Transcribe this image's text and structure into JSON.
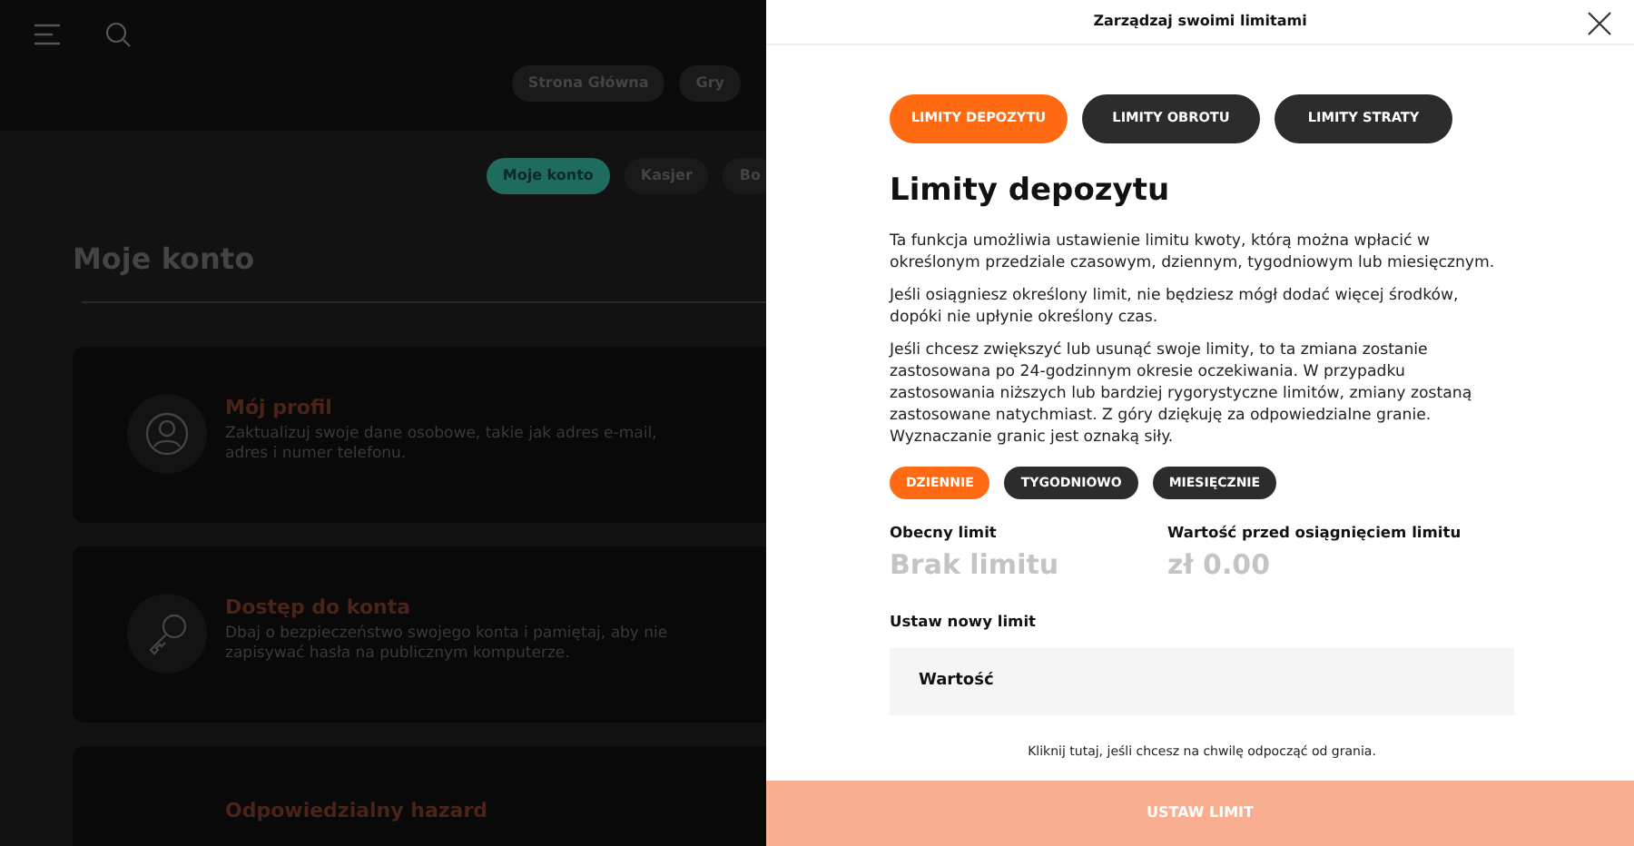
{
  "background": {
    "top_nav": [
      {
        "label": "Strona Główna"
      },
      {
        "label": "Gry"
      }
    ],
    "account_nav": [
      {
        "label": "Moje konto",
        "selected": true
      },
      {
        "label": "Kasjer",
        "selected": false
      },
      {
        "label": "Bo",
        "selected": false
      }
    ],
    "heading": "Moje konto",
    "cards": [
      {
        "kind": "profile",
        "title": "Mój profil",
        "text": "Zaktualizuj swoje dane osobowe, takie jak adres e-mail, adres i numer telefonu."
      },
      {
        "kind": "key",
        "title": "Dostęp do konta",
        "text": "Dbaj o bezpieczeństwo swojego konta i pamiętaj, aby nie zapisywać hasła na publicznym komputerze."
      },
      {
        "kind": "none",
        "title": "Odpowiedzialny hazard"
      }
    ]
  },
  "panel": {
    "title": "Zarządzaj swoimi limitami",
    "tabs": [
      {
        "label": "LIMITY DEPOZYTU",
        "selected": true
      },
      {
        "label": "LIMITY OBROTU",
        "selected": false
      },
      {
        "label": "LIMITY STRATY",
        "selected": false
      }
    ],
    "heading": "Limity depozytu",
    "paragraphs": [
      "Ta funkcja umożliwia ustawienie limitu kwoty, którą można wpłacić w określonym przedziale czasowym, dziennym, tygodniowym lub miesięcznym.",
      "Jeśli osiągniesz określony limit, nie będziesz mógł dodać więcej środków, dopóki nie upłynie określony czas.",
      "Jeśli chcesz zwiększyć lub usunąć swoje limity, to ta zmiana zostanie zastosowana po 24-godzinnym okresie oczekiwania. W przypadku zastosowania niższych lub bardziej rygorystyczne limitów, zmiany zostaną zastosowane natychmiast. Z góry dziękuję za odpowiedzialne granie. Wyznaczanie granic jest oznaką siły."
    ],
    "periods": [
      {
        "label": "DZIENNIE",
        "selected": true
      },
      {
        "label": "TYGODNIOWO",
        "selected": false
      },
      {
        "label": "MIESIĘCZNIE",
        "selected": false
      }
    ],
    "stats": [
      {
        "label": "Obecny limit",
        "value": "Brak limitu"
      },
      {
        "label": "Wartość przed osiągnięciem limitu",
        "value": "zł 0.00"
      }
    ],
    "new_limit_label": "Ustaw nowy limit",
    "field": {
      "placeholder": "Wartość"
    },
    "break_link": "Kliknij tutaj, jeśli chcesz na chwilę odpocząć od grania.",
    "submit": {
      "label": "USTAW LIMIT",
      "disabled": true
    }
  }
}
